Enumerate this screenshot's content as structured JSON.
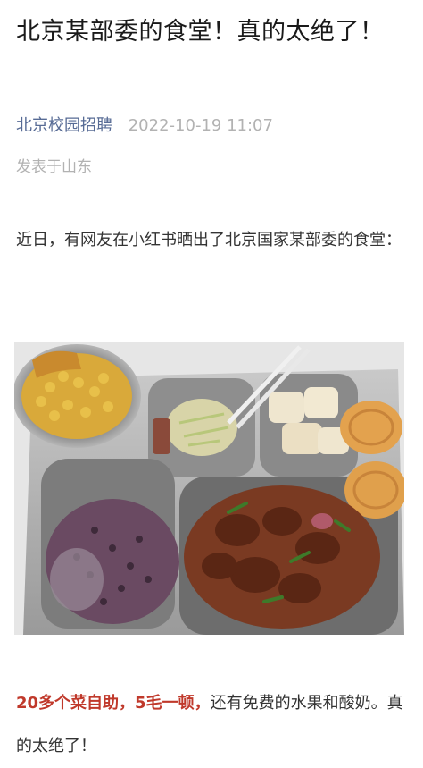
{
  "article": {
    "title": "北京某部委的食堂！真的太绝了！",
    "account": "北京校园招聘",
    "datetime": "2022-10-19 11:07",
    "location": "发表于山东",
    "intro": "近日，有网友在小红书晒出了北京国家某部委的食堂：",
    "highlight": "20多个菜自助，5毛一顿，",
    "body": "还有免费的水果和酸奶。真的太绝了！"
  },
  "colors": {
    "account": "#576b95",
    "highlight": "#c0392b",
    "meta": "#b2b2b2"
  },
  "image": {
    "description_icon": "food-tray-photo"
  }
}
